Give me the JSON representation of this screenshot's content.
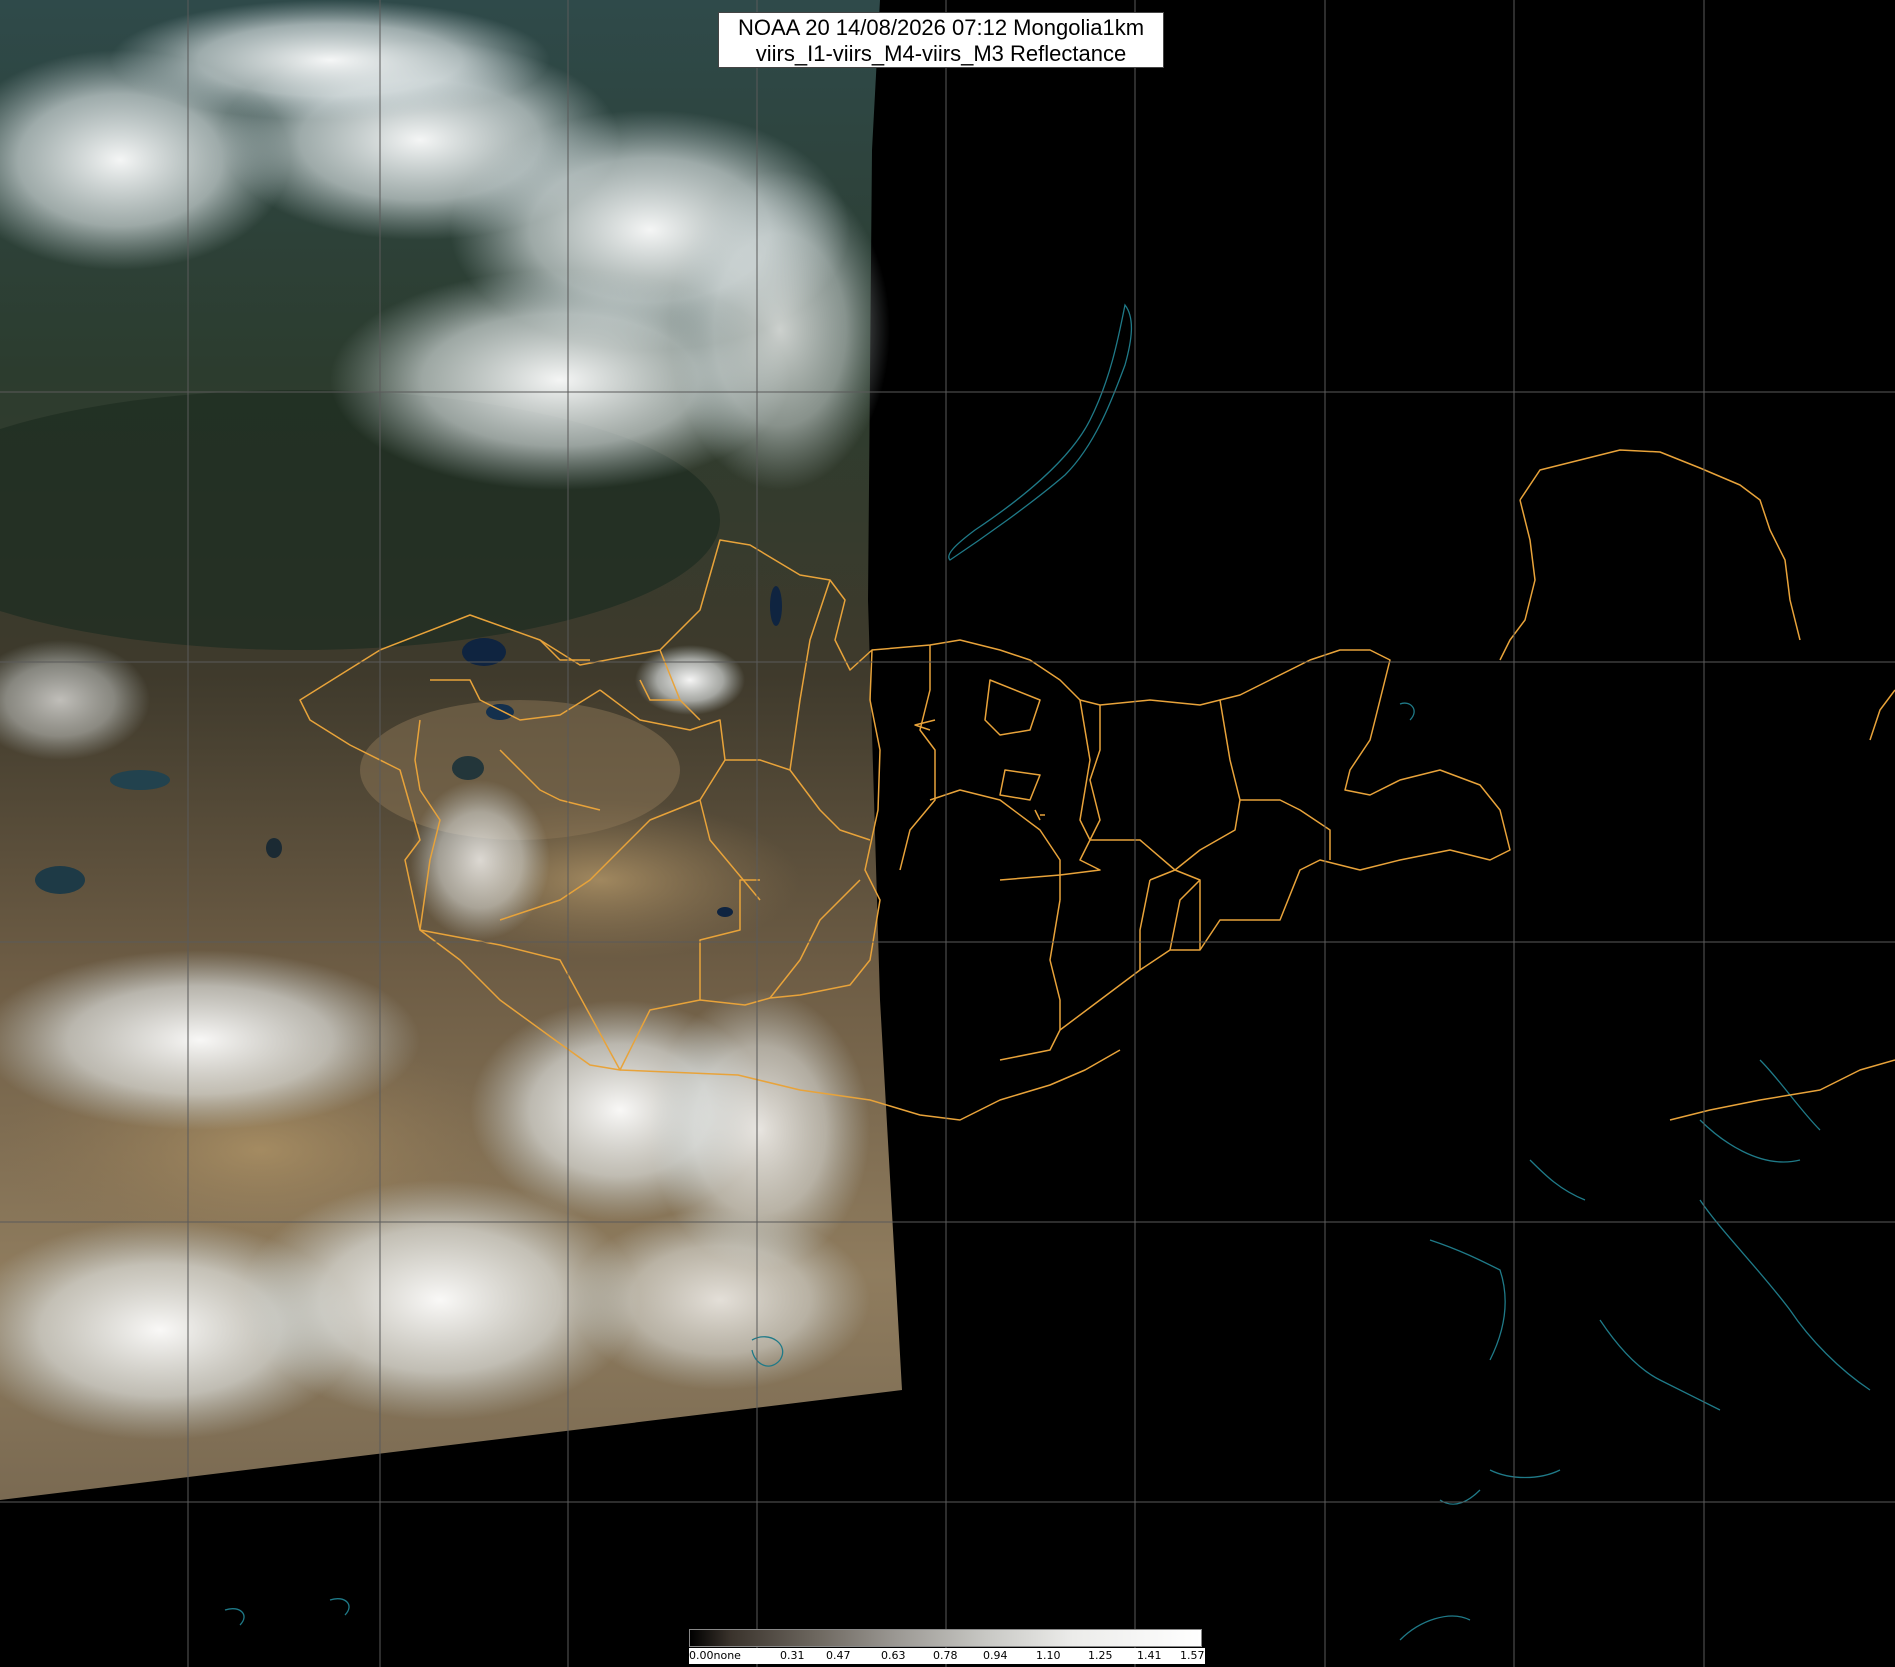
{
  "title": {
    "line1": "NOAA 20 14/08/2026 07:12 Mongolia1km",
    "line2": "viirs_I1-viirs_M4-viirs_M3 Reflectance"
  },
  "colorbar": {
    "labels": [
      "0.00none",
      "0.31",
      "0.47",
      "0.63",
      "0.78",
      "0.94",
      "1.10",
      "1.25",
      "1.41",
      "1.57"
    ]
  },
  "colors": {
    "background": "#000000",
    "grid": "#5a5a5a",
    "admin_boundary": "#e8a33a",
    "coastline": "#1f7a88"
  }
}
